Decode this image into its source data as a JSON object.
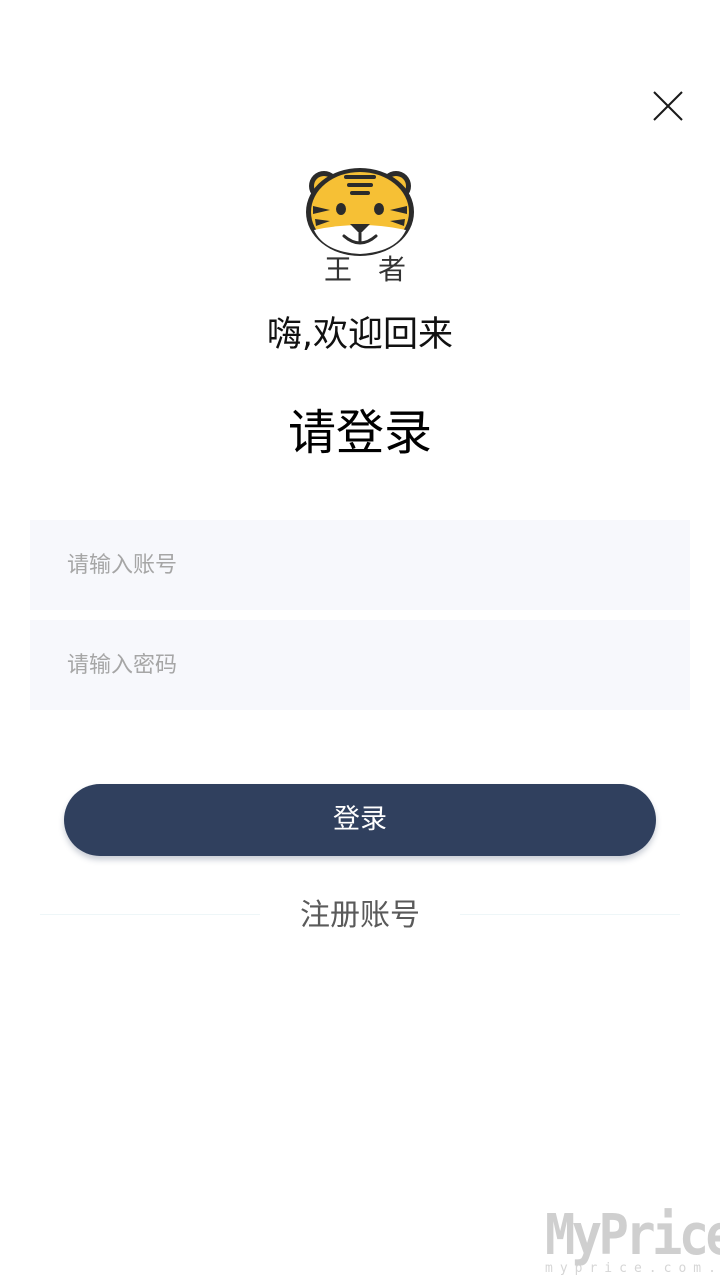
{
  "header": {
    "close_icon": "close-icon"
  },
  "logo": {
    "icon": "tiger-face-icon",
    "text": "王者",
    "colors": {
      "face": "#f6c035",
      "outline": "#2b2b2b",
      "muzzle": "#ffffff"
    }
  },
  "welcome_text": "嗨,欢迎回来",
  "title": "请登录",
  "form": {
    "account_placeholder": "请输入账号",
    "password_placeholder": "请输入密码",
    "login_label": "登录",
    "register_label": "注册账号"
  },
  "colors": {
    "primary_button": "#30405e",
    "field_background": "#f7f8fc"
  },
  "watermark": {
    "main": "MyPrice",
    "sub": "myprice.com.cn"
  }
}
